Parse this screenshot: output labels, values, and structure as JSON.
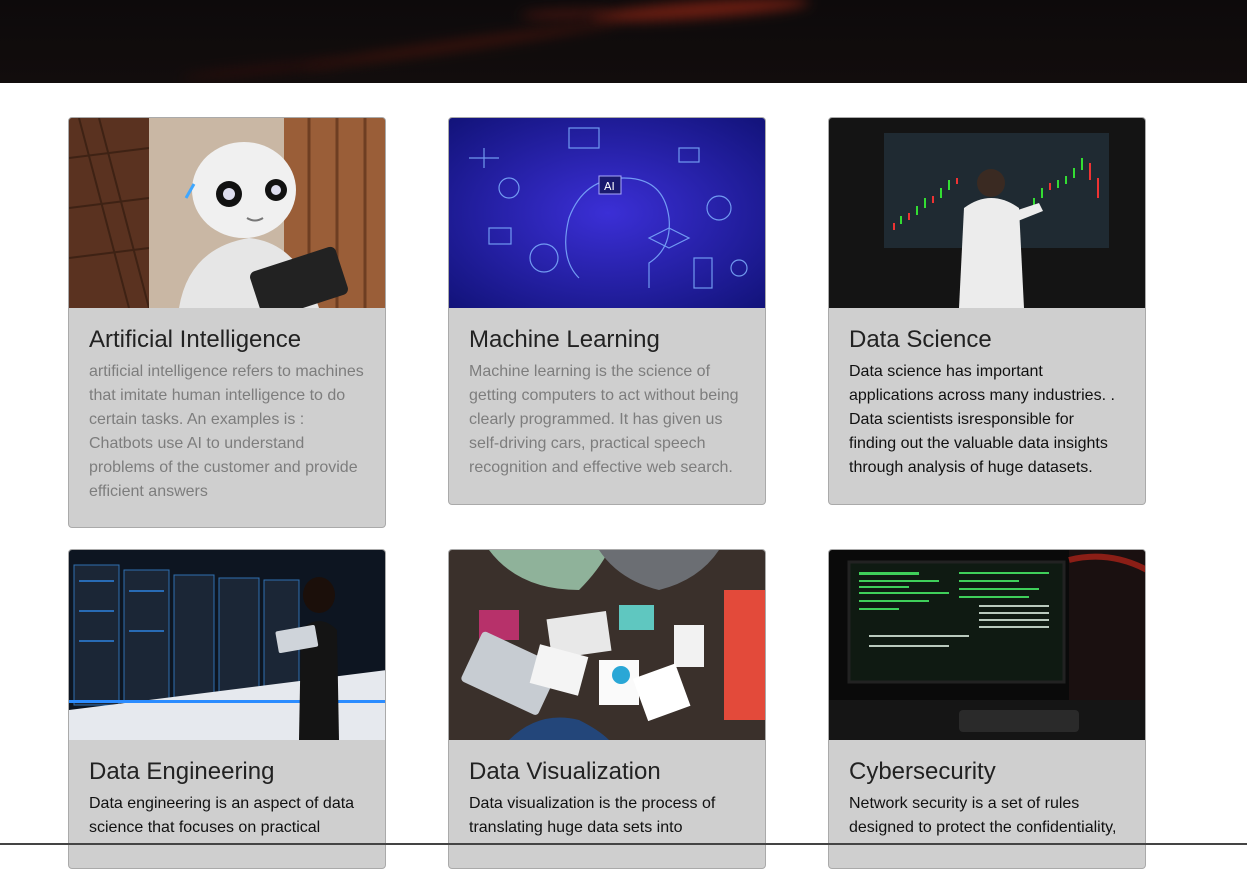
{
  "cards": [
    {
      "title": "Artificial Intelligence",
      "text": "artificial intelligence refers to machines that imitate human intelligence to do certain tasks. An examples is : Chatbots use AI to understand problems of the customer and provide efficient answers",
      "image_subject": "white humanoid robot holding a tablet"
    },
    {
      "title": "Machine Learning",
      "text": "Machine learning is the science of getting computers to act without being clearly programmed. It has given us self-driving cars, practical speech recognition and effective web search.",
      "image_subject": "blue digital head with AI circuitry icons"
    },
    {
      "title": "Data Science",
      "text": "Data science has important applications across many industries. . Data scientists isresponsible for finding out the valuable data insights through analysis of huge datasets.",
      "image_subject": "man pointing at stock candlestick chart on screen"
    },
    {
      "title": "Data Engineering",
      "text": "Data engineering is an aspect of data science that focuses on practical",
      "image_subject": "woman with laptop in server room"
    },
    {
      "title": "Data Visualization",
      "text": "Data visualization is the process of translating huge data sets into",
      "image_subject": "team at desk with charts and laptops"
    },
    {
      "title": "Cybersecurity",
      "text": "Network security is a set of rules designed to protect the confidentiality,",
      "image_subject": "monitors with green code in dark room"
    }
  ],
  "colors": {
    "card_bg": "#cfcfcf",
    "muted_text": "#7d7d7d",
    "dark_text": "#111111"
  }
}
